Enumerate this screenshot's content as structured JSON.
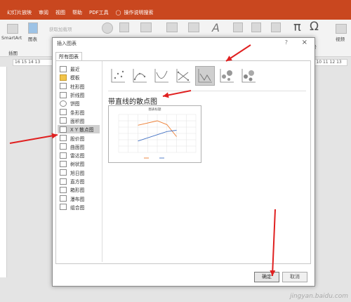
{
  "ribbon": {
    "tabs": [
      "幻灯片放映",
      "审阅",
      "视图",
      "帮助",
      "PDF工具",
      "操作说明搜索"
    ],
    "smartart": "SmartArt",
    "chart": "图表",
    "addins_label": "获取加载项",
    "group_label": "插图",
    "symbol": "符号",
    "video": "视频"
  },
  "ruler": {
    "ticks": "16  15  14  13",
    "right_ticks": "8  9  10  11  12  13"
  },
  "dialog": {
    "title": "插入图表",
    "help": "?",
    "close": "×",
    "tab_all": "所有图表",
    "categories": [
      {
        "label": "最近",
        "icon": "recent-icon"
      },
      {
        "label": "模板",
        "icon": "folder-icon"
      },
      {
        "label": "柱形图",
        "icon": "column-chart-icon"
      },
      {
        "label": "折线图",
        "icon": "line-chart-icon"
      },
      {
        "label": "饼图",
        "icon": "pie-chart-icon"
      },
      {
        "label": "条形图",
        "icon": "bar-chart-icon"
      },
      {
        "label": "面积图",
        "icon": "area-chart-icon"
      },
      {
        "label": "X Y 散点图",
        "icon": "scatter-chart-icon"
      },
      {
        "label": "股价图",
        "icon": "stock-chart-icon"
      },
      {
        "label": "曲面图",
        "icon": "surface-chart-icon"
      },
      {
        "label": "雷达图",
        "icon": "radar-chart-icon"
      },
      {
        "label": "树状图",
        "icon": "treemap-chart-icon"
      },
      {
        "label": "旭日图",
        "icon": "sunburst-chart-icon"
      },
      {
        "label": "直方图",
        "icon": "histogram-chart-icon"
      },
      {
        "label": "箱形图",
        "icon": "boxplot-chart-icon"
      },
      {
        "label": "瀑布图",
        "icon": "waterfall-chart-icon"
      },
      {
        "label": "组合图",
        "icon": "combo-chart-icon"
      }
    ],
    "selected_category": "X Y 散点图",
    "subtypes": [
      "scatter-dots",
      "scatter-smooth-markers",
      "scatter-smooth",
      "scatter-straight-markers",
      "scatter-straight",
      "bubble",
      "bubble-3d"
    ],
    "selected_subtype": "scatter-straight",
    "subtype_title": "带直线的散点图",
    "preview_title": "图表标题",
    "ok": "确定",
    "cancel": "取消"
  },
  "chart_data": {
    "type": "line",
    "title": "图表标题",
    "series": [
      {
        "name": "",
        "points": [
          [
            2,
            4.3
          ],
          [
            4,
            5
          ],
          [
            5,
            4.4
          ],
          [
            6,
            2.5
          ]
        ]
      },
      {
        "name": "",
        "points": [
          [
            2,
            1.8
          ],
          [
            4,
            2.8
          ],
          [
            5,
            3.3
          ],
          [
            6,
            3.5
          ]
        ]
      }
    ],
    "xlim": [
      0,
      8
    ],
    "ylim": [
      0,
      6
    ],
    "colors": [
      "#ed7d31",
      "#4472c4"
    ],
    "arrow_color": "#e02020"
  },
  "watermark": "jingyan.baidu.com"
}
